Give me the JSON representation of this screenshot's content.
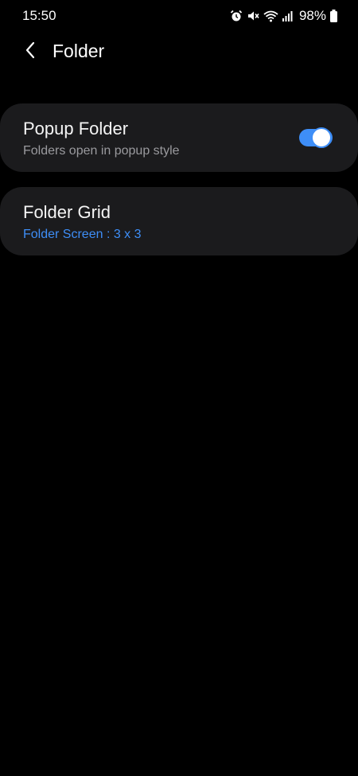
{
  "status_bar": {
    "time": "15:50",
    "battery": "98%",
    "icons": [
      "alarm-icon",
      "mute-icon",
      "wifi-icon",
      "signal-icon",
      "battery-icon"
    ]
  },
  "header": {
    "title": "Folder",
    "back_icon": "chevron-left-icon"
  },
  "settings": {
    "popup_folder": {
      "title": "Popup Folder",
      "subtitle": "Folders open in popup style",
      "enabled": true
    },
    "folder_grid": {
      "title": "Folder Grid",
      "subtitle": "Folder Screen : 3 x 3"
    }
  },
  "colors": {
    "background": "#000000",
    "card": "#1b1b1d",
    "accent": "#3e8ef7",
    "secondary_text": "#9a9a9e"
  }
}
